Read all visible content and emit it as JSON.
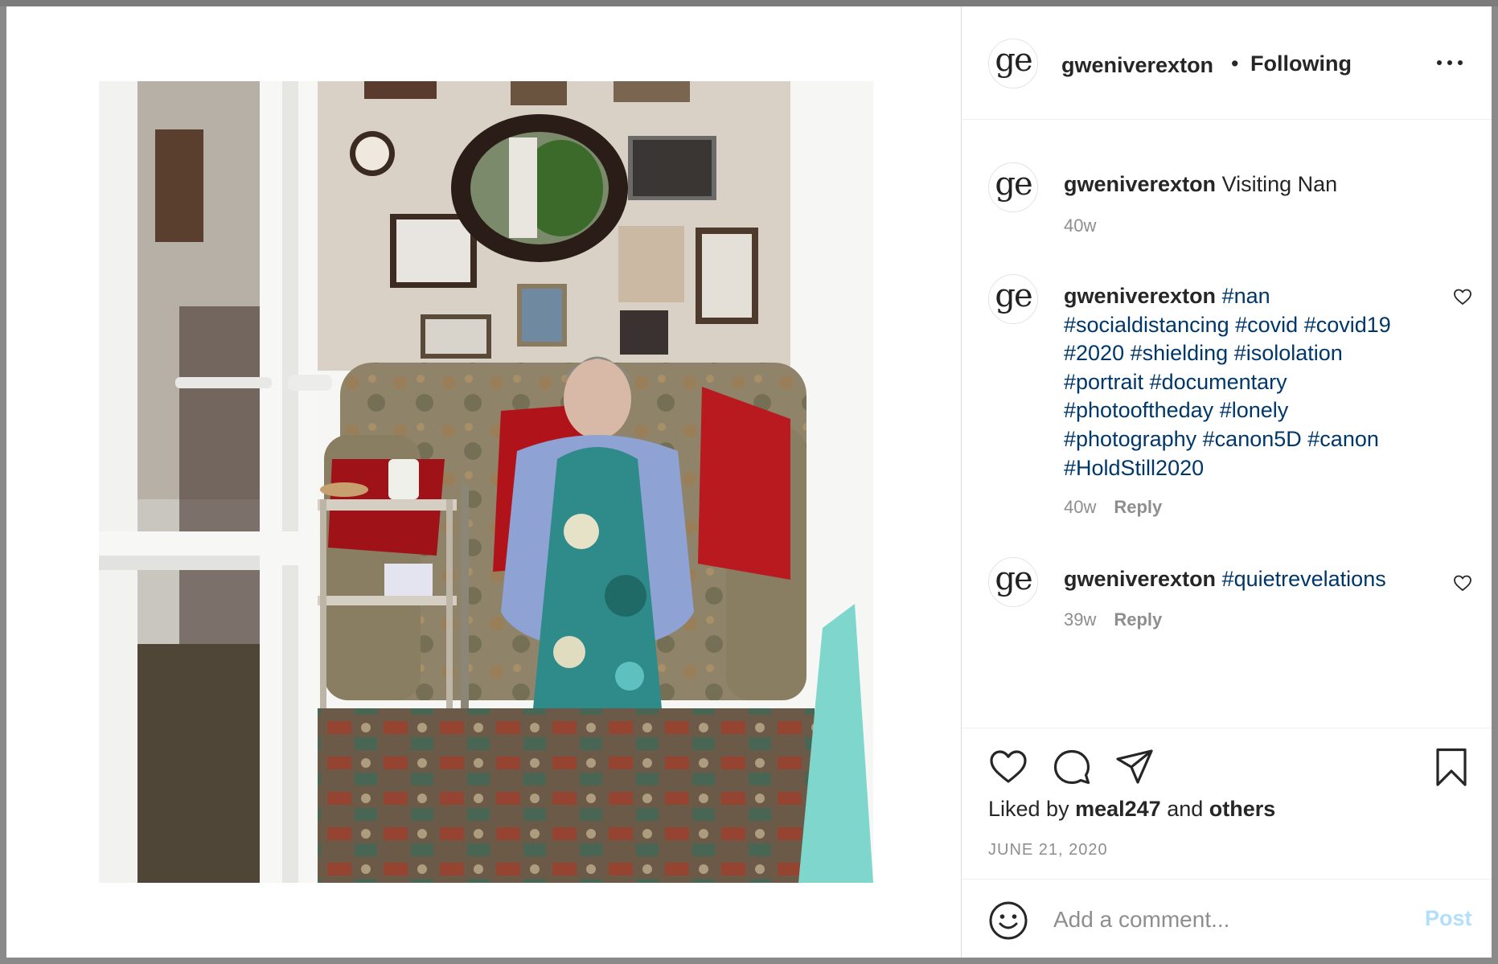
{
  "post": {
    "header": {
      "avatar_text": "ge",
      "username": "gweniverexton",
      "separator": "•",
      "follow_status": "Following"
    },
    "caption": {
      "avatar_text": "ge",
      "username": "gweniverexton",
      "text": "Visiting Nan",
      "age": "40w"
    },
    "comments": [
      {
        "avatar_text": "ge",
        "username": "gweniverexton",
        "hashtags": [
          "#nan",
          "#socialdistancing",
          "#covid",
          "#covid19",
          "#2020",
          "#shielding",
          "#isololation",
          "#portrait",
          "#documentary",
          "#photooftheday",
          "#lonely",
          "#photography",
          "#canon5D",
          "#canon",
          "#HoldStill2020"
        ],
        "age": "40w",
        "reply_label": "Reply"
      },
      {
        "avatar_text": "ge",
        "username": "gweniverexton",
        "hashtags": [
          "#quietrevelations"
        ],
        "age": "39w",
        "reply_label": "Reply"
      }
    ],
    "actions": {
      "like_icon": "heart-icon",
      "comment_icon": "comment-bubble-icon",
      "share_icon": "paper-plane-icon",
      "save_icon": "bookmark-icon"
    },
    "likes": {
      "prefix": "Liked by",
      "user": "meal247",
      "conjunction": "and",
      "others": "others"
    },
    "date": "JUNE 21, 2020",
    "add_comment": {
      "placeholder": "Add a comment...",
      "post_label": "Post",
      "emoji_icon": "smiley-icon"
    }
  },
  "colors": {
    "text": "#262626",
    "muted": "#8e8e8e",
    "hashtag": "#00376b",
    "post_disabled": "#b2dffc",
    "divider": "#efefef"
  }
}
